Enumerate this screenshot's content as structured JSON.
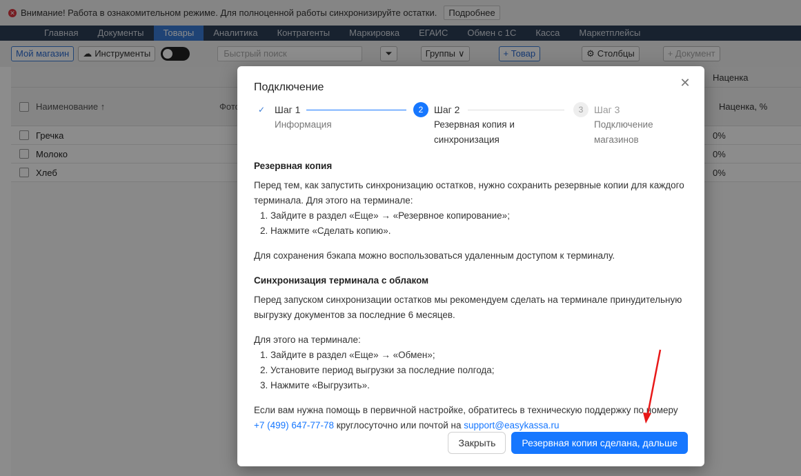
{
  "warning": {
    "text": "Внимание! Работа в ознакомительном режиме. Для полноценной работы синхронизируйте остатки.",
    "more_label": "Подробнее"
  },
  "nav": {
    "items": [
      "Главная",
      "Документы",
      "Товары",
      "Аналитика",
      "Контрагенты",
      "Маркировка",
      "ЕГАИС",
      "Обмен с 1С",
      "Касса",
      "Маркетплейсы"
    ],
    "active": "Товары"
  },
  "toolbar": {
    "shop_label": "Мой магазин",
    "tools_label": "Инструменты",
    "search_placeholder": "Быстрый поиск",
    "groups_label": "Группы",
    "add_product_label": "+ Товар",
    "columns_label": "Столбцы",
    "add_doc_label": "+ Документ"
  },
  "table": {
    "name_header": "Наименование ↑",
    "photo_header": "Фото",
    "markup_group": "Наценка",
    "markup_pct_header": "Наценка, %",
    "rows": [
      {
        "name": "Гречка",
        "markup": "0%"
      },
      {
        "name": "Молоко",
        "markup": "0%"
      },
      {
        "name": "Хлеб",
        "markup": "0%"
      }
    ]
  },
  "modal": {
    "title": "Подключение",
    "steps": [
      {
        "num": "✓",
        "label": "Шаг 1",
        "desc": "Информация",
        "state": "done"
      },
      {
        "num": "2",
        "label": "Шаг 2",
        "desc": "Резервная копия и\nсинхронизация",
        "state": "active"
      },
      {
        "num": "3",
        "label": "Шаг 3",
        "desc": "Подключение\nмагазинов",
        "state": "wait"
      }
    ],
    "backup_title": "Резервная копия",
    "backup_text": "Перед тем, как запустить синхронизацию остатков, нужно сохранить резервные копии для каждого терминала. Для этого на терминале:",
    "backup_steps": [
      "Зайдите в раздел «Еще» → «Резервное копирование»;",
      "Нажмите «Сделать копию»."
    ],
    "remote_text": "Для сохранения бэкапа можно воспользоваться удаленным доступом к терминалу.",
    "sync_title": "Синхронизация терминала с облаком",
    "sync_text": "Перед запуском синхронизации остатков мы рекомендуем сделать на терминале принудительную выгрузку документов за последние 6 месяцев.",
    "sync_intro": "Для этого на терминале:",
    "sync_steps": [
      "Зайдите в раздел «Еще» → «Обмен»;",
      "Установите период выгрузки за последние полгода;",
      "Нажмите «Выгрузить»."
    ],
    "help_text_1": "Если вам нужна помощь в первичной настройке, обратитесь в техническую поддержку по номеру",
    "help_phone": "+7 (499) 647-77-78",
    "help_text_2": "круглосуточно или почтой на",
    "help_email": "support@easykassa.ru",
    "close_label": "Закрыть",
    "next_label": "Резервная копия сделана, дальше"
  }
}
